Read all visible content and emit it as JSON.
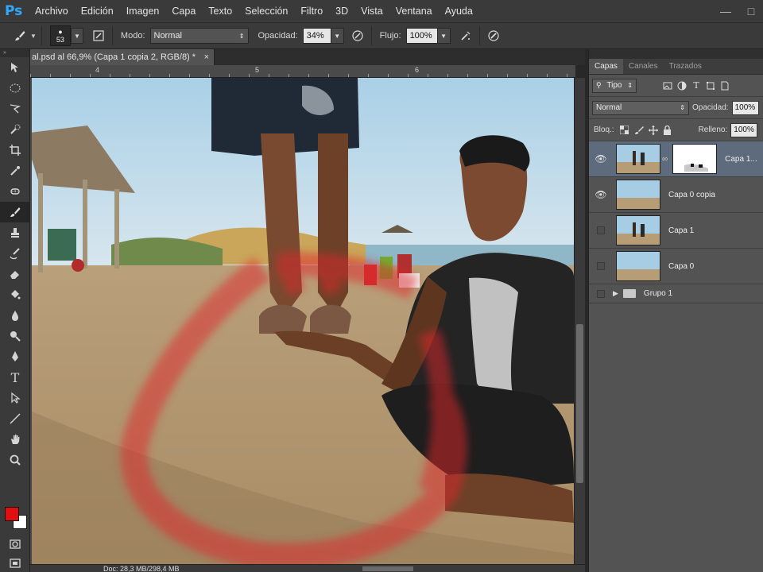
{
  "app": {
    "logo": "Ps",
    "menu": [
      "Archivo",
      "Edición",
      "Imagen",
      "Capa",
      "Texto",
      "Selección",
      "Filtro",
      "3D",
      "Vista",
      "Ventana",
      "Ayuda"
    ]
  },
  "options": {
    "brush_size": "53",
    "mode_label": "Modo:",
    "mode_value": "Normal",
    "opacity_label": "Opacidad:",
    "opacity_value": "34%",
    "flow_label": "Flujo:",
    "flow_value": "100%"
  },
  "document": {
    "tab_title": "al.psd al 66,9% (Capa 1 copia 2, RGB/8) *",
    "close": "×",
    "ruler_numbers": [
      "4",
      "5",
      "6"
    ],
    "status": "Doc: 28,3 MB/298,4 MB"
  },
  "colors": {
    "foreground": "#e01010",
    "background": "#ffffff",
    "ps_blue": "#31a8ff"
  },
  "layers_panel": {
    "tabs": [
      "Capas",
      "Canales",
      "Trazados"
    ],
    "filter": "Tipo",
    "blend_mode": "Normal",
    "opacity_label": "Opacidad:",
    "opacity_value": "100%",
    "lock_label": "Bloq.:",
    "fill_label": "Relleno:",
    "fill_value": "100%",
    "layers": [
      {
        "name": "Capa 1...",
        "visible": true,
        "selected": true
      },
      {
        "name": "Capa 0 copia",
        "visible": true,
        "selected": false
      },
      {
        "name": "Capa 1",
        "visible": false,
        "selected": false
      },
      {
        "name": "Capa 0",
        "visible": false,
        "selected": false
      }
    ],
    "group": "Grupo 1"
  },
  "icons": {
    "brush": "brush-icon",
    "eye": "eye-icon",
    "folder": "folder-icon",
    "chain": "chain-link-icon"
  }
}
